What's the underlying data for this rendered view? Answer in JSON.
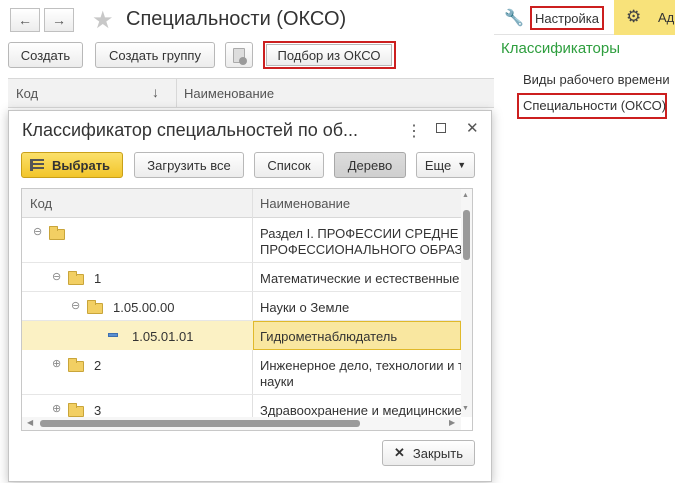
{
  "window": {
    "title": "Специальности (ОКСО)",
    "back_glyph": "←",
    "forward_glyph": "→",
    "star_glyph": "★"
  },
  "toolbar": {
    "create_label": "Создать",
    "create_group_label": "Создать группу",
    "pick_okso_label": "Подбор из ОКСО"
  },
  "list_header": {
    "col_code": "Код",
    "sort_glyph": "↓",
    "col_name": "Наименование"
  },
  "right_panel": {
    "settings_label": "Настройка",
    "admin_label_partial": "Ад",
    "section_title": "Классификаторы",
    "links": [
      "Виды рабочего времени",
      "Специальности (ОКСО)"
    ]
  },
  "dialog": {
    "title": "Классификатор специальностей по об...",
    "menu_glyph": "⋮",
    "maximize_glyph": "☐",
    "close_glyph": "✕",
    "buttons": {
      "select": "Выбрать",
      "load_all": "Загрузить все",
      "list": "Список",
      "tree": "Дерево",
      "more": "Еще"
    },
    "grid": {
      "col_code": "Код",
      "col_name": "Наименование"
    },
    "rows": [
      {
        "code": "",
        "name_line1": "Раздел I. ПРОФЕССИИ СРЕДНЕ",
        "name_line2": "ПРОФЕССИОНАЛЬНОГО ОБРАЗ",
        "expander": "⊖"
      },
      {
        "code": "1",
        "name_line1": "Математические и естественные",
        "expander": "⊖"
      },
      {
        "code": "1.05.00.00",
        "name_line1": "Науки о Земле",
        "expander": "⊖"
      },
      {
        "code": "1.05.01.01",
        "name_line1": "Гидрометнаблюдатель"
      },
      {
        "code": "2",
        "name_line1": "Инженерное дело, технологии и т",
        "name_line2": "науки",
        "expander": "⊕"
      },
      {
        "code": "3",
        "name_line1": "Здравоохранение и медицинские",
        "expander": "⊕"
      }
    ],
    "close_button_label": "Закрыть",
    "close_button_glyph": "✕"
  },
  "colors": {
    "accent_green": "#2e9e3e",
    "highlight_red": "#cc1f1f",
    "select_yellow": "#f7d038",
    "selected_row": "#fbf1c4"
  }
}
